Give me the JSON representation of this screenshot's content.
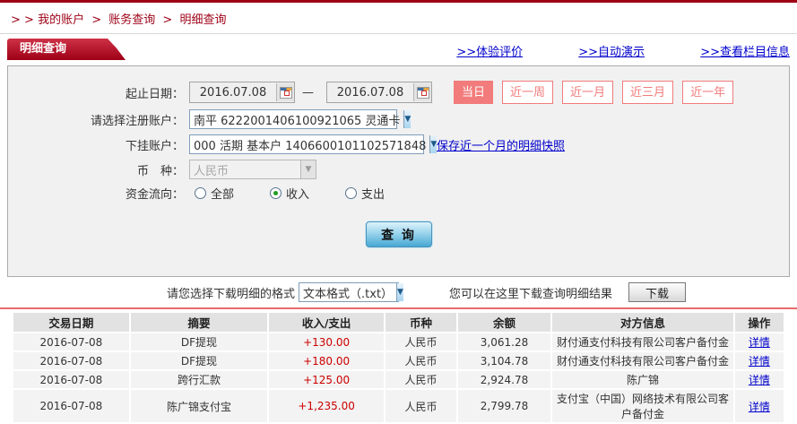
{
  "colors": {
    "brand_red": "#9E0016",
    "salmon": "#F27B7B",
    "link_blue": "#0000CC",
    "amount_red": "#CC0000",
    "query_button_blue": "#47A7D4"
  },
  "breadcrumb": {
    "prefix": "> >",
    "separator": ">",
    "items": [
      "我的账户",
      "账务查询",
      "明细查询"
    ]
  },
  "tab_title": "明细查询",
  "header_links": [
    ">>体验评价",
    ">>自动演示",
    ">>查看栏目信息"
  ],
  "form": {
    "date_label": "起止日期：",
    "date_from": "2016.07.08",
    "date_separator": "—",
    "date_to": "2016.07.08",
    "quick_buttons": [
      {
        "label": "当日",
        "active": true
      },
      {
        "label": "近一周",
        "active": false
      },
      {
        "label": "近一月",
        "active": false
      },
      {
        "label": "近三月",
        "active": false
      },
      {
        "label": "近一年",
        "active": false
      }
    ],
    "register_account_label": "请选择注册账户：",
    "register_account_value": "南平 6222001406100921065 灵通卡",
    "sub_account_label": "下挂账户：",
    "sub_account_value": "000 活期 基本户 1406600101102571848",
    "snapshot_link": "保存近一个月的明细快照",
    "currency_label": "币　种：",
    "currency_value": "人民币",
    "flow_label": "资金流向：",
    "flow_options": [
      {
        "label": "全部",
        "checked": false
      },
      {
        "label": "收入",
        "checked": true
      },
      {
        "label": "支出",
        "checked": false
      }
    ],
    "query_button": "查 询"
  },
  "download": {
    "format_label": "请您选择下载明细的格式",
    "format_value": "文本格式（.txt）",
    "hint": "您可以在这里下载查询明细结果",
    "button": "下载"
  },
  "table": {
    "headers": [
      "交易日期",
      "摘要",
      "收入/支出",
      "币种",
      "余额",
      "对方信息",
      "操作"
    ],
    "rows": [
      {
        "date": "2016-07-08",
        "summary": "DF提现",
        "amount": "+130.00",
        "currency": "人民币",
        "balance": "3,061.28",
        "counterparty": "财付通支付科技有限公司客户备付金",
        "action": "详情"
      },
      {
        "date": "2016-07-08",
        "summary": "DF提现",
        "amount": "+180.00",
        "currency": "人民币",
        "balance": "3,104.78",
        "counterparty": "财付通支付科技有限公司客户备付金",
        "action": "详情"
      },
      {
        "date": "2016-07-08",
        "summary": "跨行汇款",
        "amount": "+125.00",
        "currency": "人民币",
        "balance": "2,924.78",
        "counterparty": "陈广锦",
        "action": "详情"
      },
      {
        "date": "2016-07-08",
        "summary": "陈广锦支付宝",
        "amount": "+1,235.00",
        "currency": "人民币",
        "balance": "2,799.78",
        "counterparty": "支付宝（中国）网络技术有限公司客户备付金",
        "action": "详情"
      }
    ]
  }
}
